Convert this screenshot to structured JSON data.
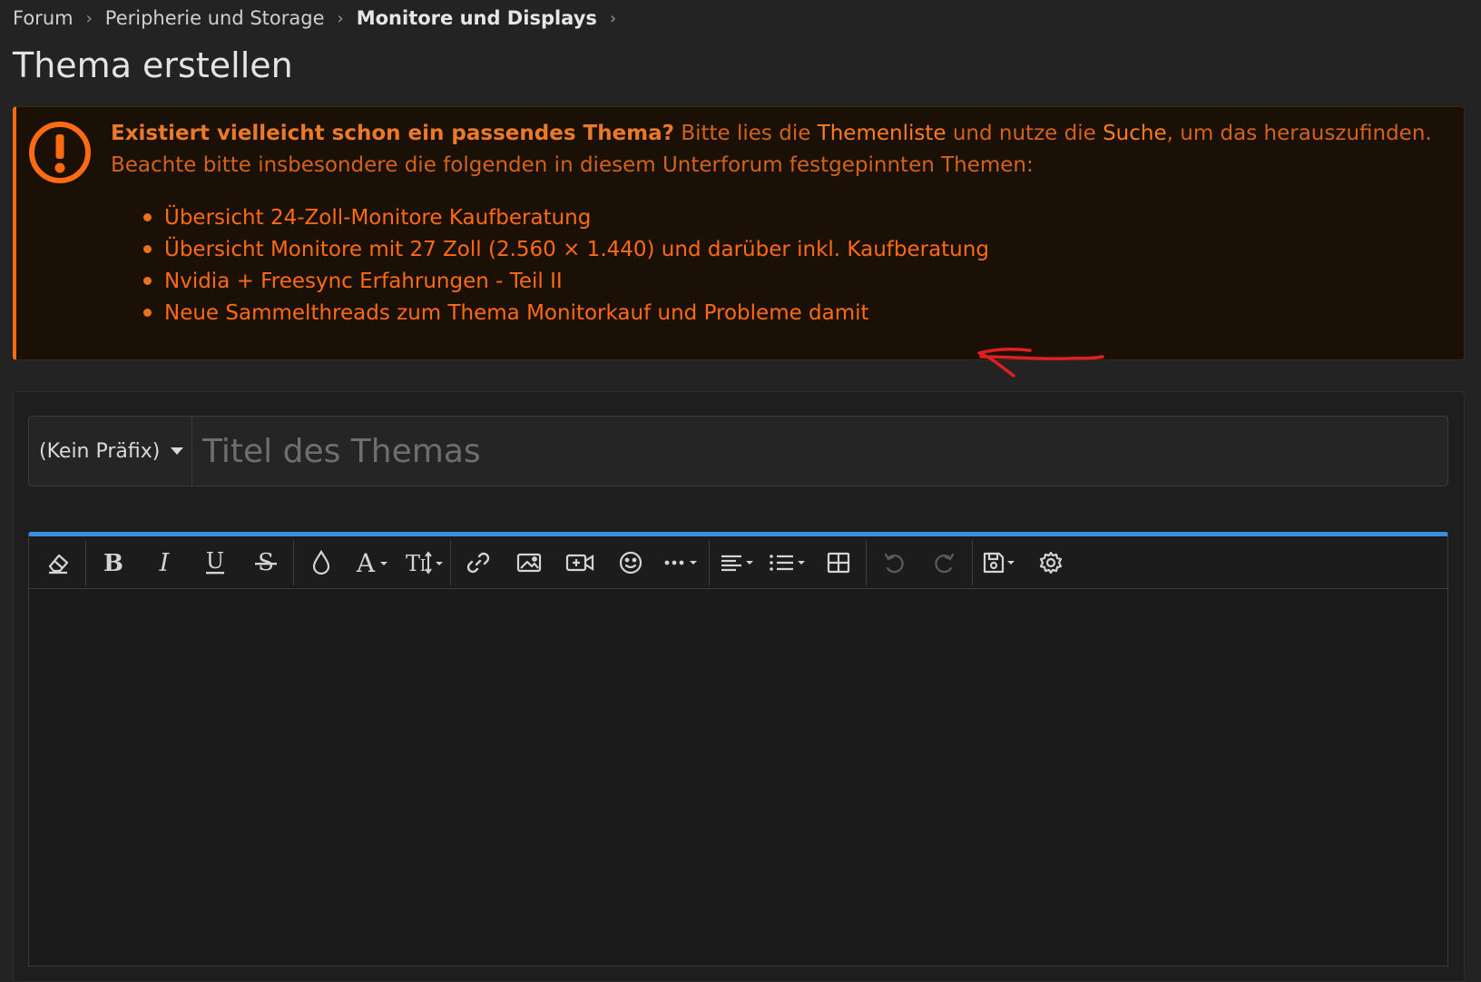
{
  "breadcrumb": {
    "items": [
      "Forum",
      "Peripherie und Storage",
      "Monitore und Displays"
    ]
  },
  "page": {
    "title": "Thema erstellen"
  },
  "notice": {
    "icon": "exclamation-circle-icon",
    "accent_color": "#ff6a12",
    "lead_bold": "Existiert vielleicht schon ein passendes Thema?",
    "text_1": " Bitte lies die ",
    "link_themenliste": "Themenliste",
    "text_2": " und nutze die ",
    "link_suche": "Suche",
    "text_3": ", um das herauszufinden. Beachte bitte insbesondere die folgenden in diesem Unterforum festgepinnten Themen:",
    "pinned_threads": [
      "Übersicht 24-Zoll-Monitore Kaufberatung",
      "Übersicht Monitore mit 27 Zoll (2.560 × 1.440) und darüber inkl. Kaufberatung",
      "Nvidia + Freesync Erfahrungen - Teil II",
      "Neue Sammelthreads zum Thema Monitorkauf und Probleme damit"
    ],
    "annotation": "red hand-drawn arrow pointing at second thread"
  },
  "form": {
    "prefix_value": "(Kein Präfix)",
    "title_placeholder": "Titel des Themas"
  },
  "editor": {
    "accent_color": "#3d8de0",
    "toolbar": [
      "eraser-icon",
      "bold-icon",
      "italic-icon",
      "underline-icon",
      "strikethrough-icon",
      "text-color-icon",
      "font-family-icon",
      "font-size-icon",
      "link-icon",
      "image-icon",
      "video-icon",
      "emoji-icon",
      "more-icon",
      "align-icon",
      "list-icon",
      "table-icon",
      "undo-icon",
      "redo-icon",
      "drafts-icon",
      "settings-icon"
    ]
  }
}
